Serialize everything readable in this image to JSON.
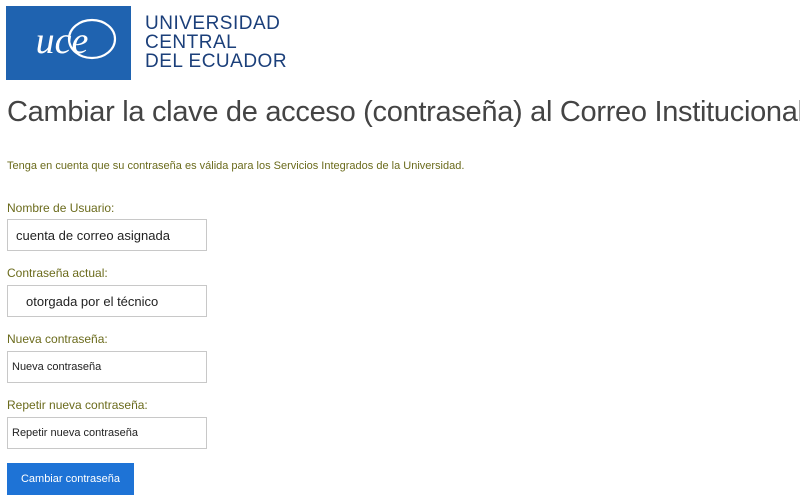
{
  "header": {
    "logo_text": "uce",
    "university_name": [
      "UNIVERSIDAD",
      "CENTRAL",
      "DEL ECUADOR"
    ]
  },
  "page": {
    "title": "Cambiar la clave de acceso (contraseña) al Correo Institucional",
    "notice": "Tenga en cuenta que su contraseña es válida para los Servicios Integrados de la Universidad."
  },
  "form": {
    "username": {
      "label": "Nombre de Usuario:",
      "value": "cuenta de correo asignada"
    },
    "current_password": {
      "label": "Contraseña actual:",
      "value": "otorgada por el técnico"
    },
    "new_password": {
      "label": "Nueva contraseña:",
      "placeholder": "Nueva contraseña"
    },
    "repeat_password": {
      "label": "Repetir nueva contraseña:",
      "placeholder": "Repetir nueva contraseña"
    },
    "submit_label": "Cambiar contraseña"
  },
  "colors": {
    "brand_blue": "#1f63b0",
    "button_blue": "#1e73d6",
    "label_olive": "#6b6b1c"
  }
}
